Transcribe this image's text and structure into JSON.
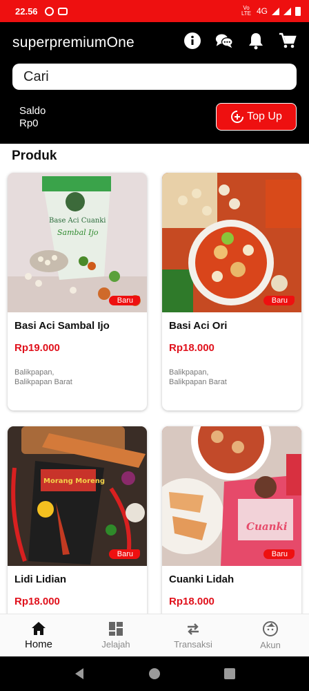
{
  "status_bar": {
    "time": "22.56",
    "network": "4G",
    "volte": "Vo LTE"
  },
  "header": {
    "app_title": "superpremiumOne",
    "icons": [
      "info-icon",
      "chat-icon",
      "bell-icon",
      "cart-icon"
    ],
    "search_placeholder": "Cari",
    "saldo_label": "Saldo",
    "saldo_value": "Rp0",
    "topup_label": "Top Up"
  },
  "section_title": "Produk",
  "products": [
    {
      "name": "Basi Aci Sambal Ijo",
      "price": "Rp19.000",
      "location_line1": "Balikpapan,",
      "location_line2": "Balikpapan Barat",
      "badge": "Baru",
      "package_text": "Base Aci Cuanki",
      "package_sub": "Sambal Ijo"
    },
    {
      "name": "Basi Aci Ori",
      "price": "Rp18.000",
      "location_line1": "Balikpapan,",
      "location_line2": "Balikpapan Barat",
      "badge": "Baru"
    },
    {
      "name": "Lidi Lidian",
      "price": "Rp18.000",
      "badge": "Baru",
      "package_text": "Morang Moreng"
    },
    {
      "name": "Cuanki Lidah",
      "price": "Rp18.000",
      "badge": "Baru",
      "package_text": "Cuanki"
    }
  ],
  "bottom_nav": [
    {
      "label": "Home",
      "icon": "home-icon",
      "active": true
    },
    {
      "label": "Jelajah",
      "icon": "grid-icon",
      "active": false
    },
    {
      "label": "Transaksi",
      "icon": "swap-icon",
      "active": false
    },
    {
      "label": "Akun",
      "icon": "face-icon",
      "active": false
    }
  ],
  "colors": {
    "accent": "#ee1010",
    "price": "#e0111c",
    "header_bg": "#000000"
  }
}
